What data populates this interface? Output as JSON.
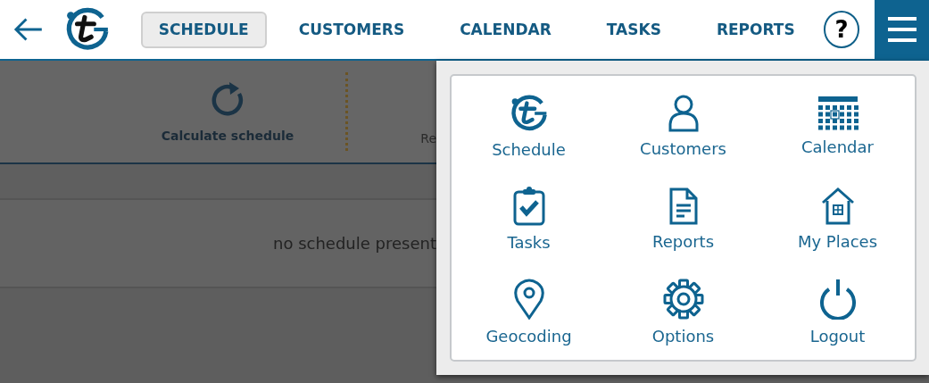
{
  "header": {
    "nav": [
      {
        "label": "SCHEDULE",
        "selected": true
      },
      {
        "label": "CUSTOMERS",
        "selected": false
      },
      {
        "label": "CALENDAR",
        "selected": false
      },
      {
        "label": "TASKS",
        "selected": false
      },
      {
        "label": "REPORTS",
        "selected": false
      }
    ],
    "help": "?"
  },
  "toolbar": [
    {
      "kind": "calculate",
      "label": "Calculate schedule"
    },
    {
      "kind": "partial",
      "label": "Re"
    }
  ],
  "message": "no schedule present",
  "menu": {
    "items": [
      {
        "kind": "logo",
        "label": "Schedule"
      },
      {
        "kind": "person",
        "label": "Customers"
      },
      {
        "kind": "calendar",
        "label": "Calendar"
      },
      {
        "kind": "clipboard",
        "label": "Tasks"
      },
      {
        "kind": "document",
        "label": "Reports"
      },
      {
        "kind": "house",
        "label": "My Places"
      },
      {
        "kind": "pin",
        "label": "Geocoding"
      },
      {
        "kind": "gear",
        "label": "Options"
      },
      {
        "kind": "power",
        "label": "Logout"
      }
    ]
  }
}
